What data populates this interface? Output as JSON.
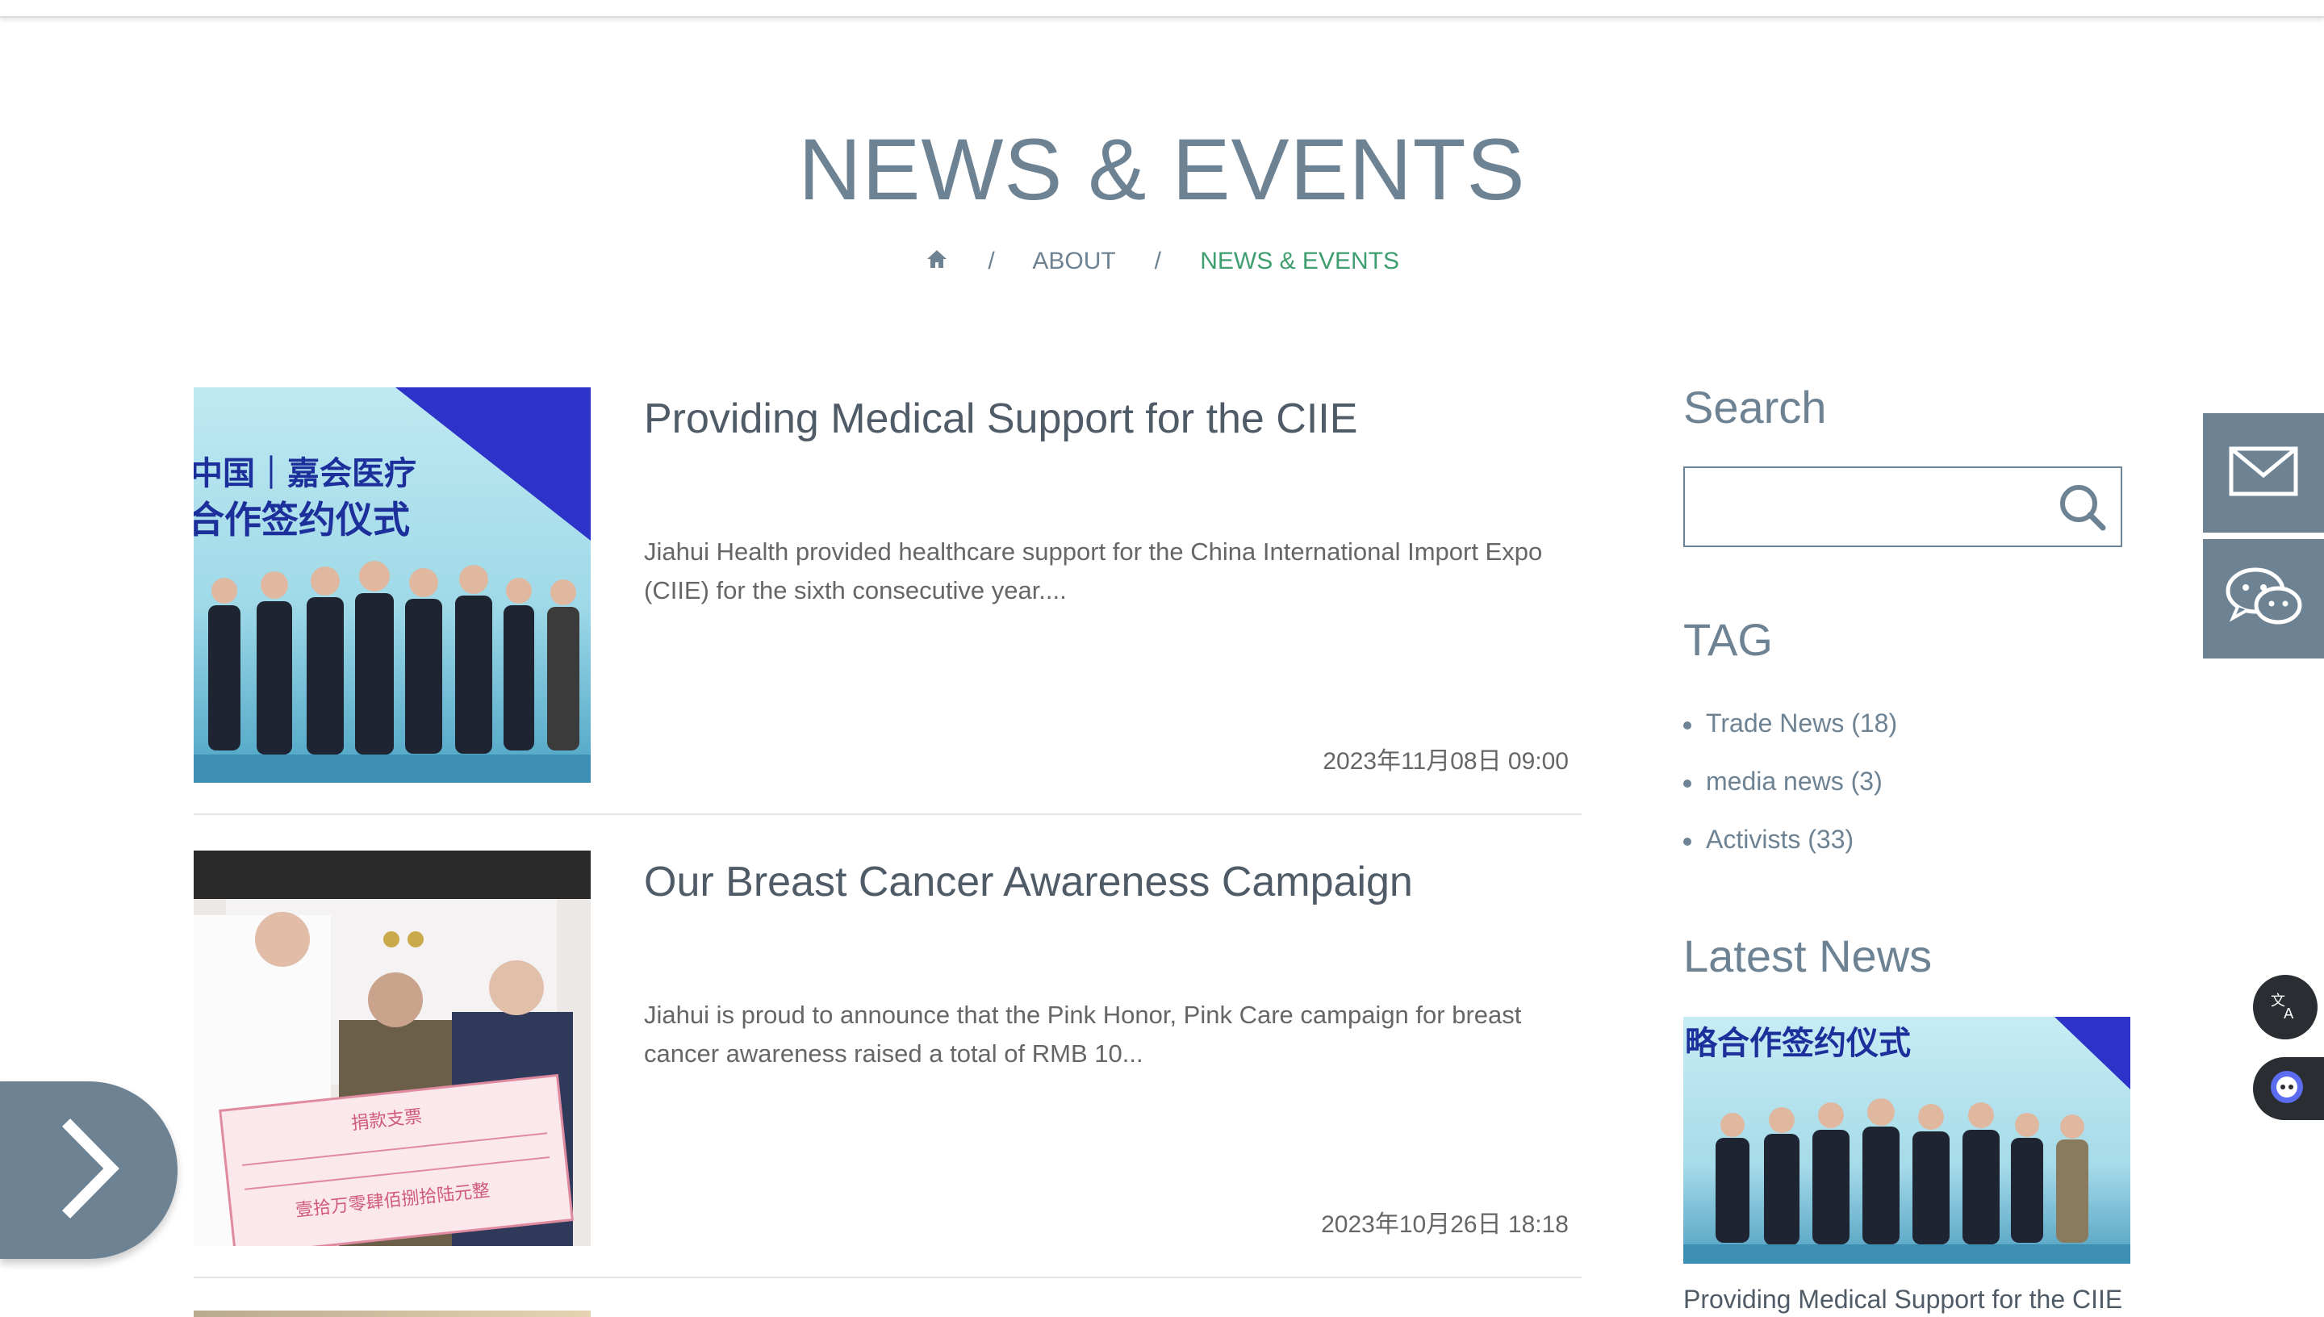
{
  "page": {
    "title": "NEWS & EVENTS"
  },
  "breadcrumb": {
    "home_icon": "home-icon",
    "separator": "/",
    "items": [
      "ABOUT",
      "NEWS & EVENTS"
    ]
  },
  "articles": [
    {
      "title": "Providing Medical Support for the CIIE",
      "summary": "Jiahui Health provided healthcare support for the China International Import Expo (CIIE) for the sixth consecutive year....",
      "date": "2023年11月08日 09:00",
      "image_text": [
        "中国｜嘉会医疗",
        "合作签约仪式"
      ]
    },
    {
      "title": "Our Breast Cancer Awareness Campaign",
      "summary": "Jiahui is proud to announce that the Pink Honor, Pink Care campaign for breast cancer awareness raised a total of RMB 10...",
      "date": "2023年10月26日 18:18",
      "image_text": [
        "捐款支票",
        "壹拾万零肆佰捌拾陆元整"
      ]
    }
  ],
  "sidebar": {
    "search_heading": "Search",
    "search_placeholder": "",
    "search_icon": "search-icon",
    "tag_heading": "TAG",
    "tags": [
      "Trade News (18)",
      "media news (3)",
      "Activists (33)"
    ],
    "latest_heading": "Latest News",
    "latest": {
      "caption": "Providing Medical Support for the CIIE",
      "image_text": "略合作签约仪式"
    }
  },
  "floating": {
    "mail_icon": "mail-icon",
    "wechat_icon": "wechat-icon",
    "translate_icon": "translate-icon",
    "assistant_icon": "assistant-icon",
    "next_icon": "chevron-right-icon"
  },
  "colors": {
    "accent": "#6d8293",
    "active": "#3f9e6f"
  }
}
